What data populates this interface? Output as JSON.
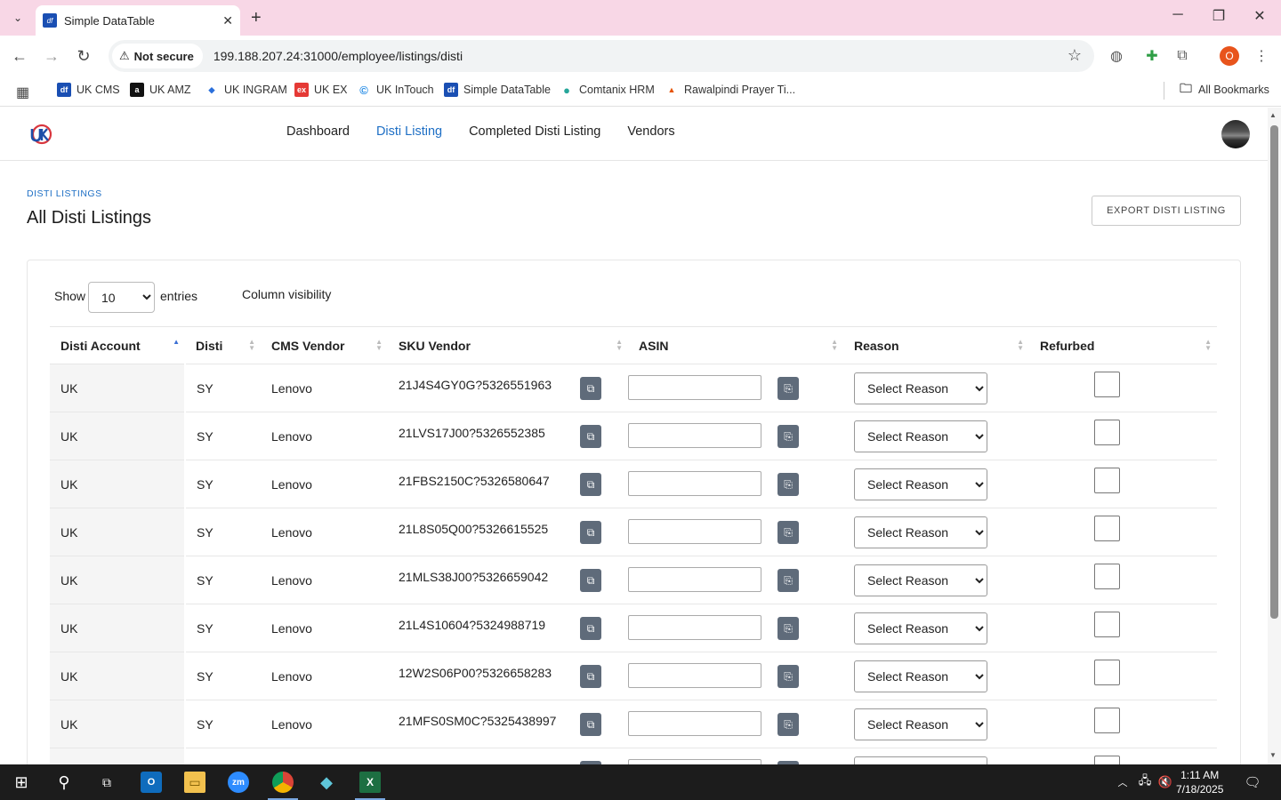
{
  "browser": {
    "tab_title": "Simple DataTable",
    "tab_favicon": "df",
    "security_label": "Not secure",
    "url": "199.188.207.24:31000/employee/listings/disti",
    "profile_initial": "O",
    "bookmarks": [
      {
        "label": "UK CMS",
        "color": "#1a4fb3",
        "glyph": "df"
      },
      {
        "label": "UK AMZ",
        "color": "#111111",
        "glyph": "a"
      },
      {
        "label": "UK INGRAM",
        "color": "#2a6fdb",
        "glyph": "◆"
      },
      {
        "label": "UK EX",
        "color": "#e53935",
        "glyph": "ex"
      },
      {
        "label": "UK InTouch",
        "color": "#1e88e5",
        "glyph": "©"
      },
      {
        "label": "Simple DataTable",
        "color": "#1a4fb3",
        "glyph": "df"
      },
      {
        "label": "Comtanix HRM",
        "color": "#26a69a",
        "glyph": "●"
      },
      {
        "label": "Rawalpindi Prayer Ti...",
        "color": "#e65100",
        "glyph": "▲"
      }
    ],
    "all_bookmarks_label": "All Bookmarks"
  },
  "app": {
    "nav": [
      "Dashboard",
      "Disti Listing",
      "Completed Disti Listing",
      "Vendors"
    ],
    "active_nav": "Disti Listing",
    "accent_color": "#1e6fc5"
  },
  "page": {
    "breadcrumb": "DISTI LISTINGS",
    "title": "All Disti Listings",
    "export_button": "EXPORT DISTI LISTING"
  },
  "table_controls": {
    "show_label": "Show",
    "entries_value": "10",
    "entries_label": "entries",
    "column_visibility": "Column visibility"
  },
  "table": {
    "headers": [
      "Disti Account",
      "Disti",
      "CMS Vendor",
      "SKU Vendor",
      "ASIN",
      "Reason",
      "Refurbed"
    ],
    "reason_placeholder": "Select Reason",
    "rows": [
      {
        "account": "UK",
        "disti": "SY",
        "vendor": "Lenovo",
        "sku": "21J4S4GY0G?5326551963"
      },
      {
        "account": "UK",
        "disti": "SY",
        "vendor": "Lenovo",
        "sku": "21LVS17J00?5326552385"
      },
      {
        "account": "UK",
        "disti": "SY",
        "vendor": "Lenovo",
        "sku": "21FBS2150C?5326580647"
      },
      {
        "account": "UK",
        "disti": "SY",
        "vendor": "Lenovo",
        "sku": "21L8S05Q00?5326615525"
      },
      {
        "account": "UK",
        "disti": "SY",
        "vendor": "Lenovo",
        "sku": "21MLS38J00?5326659042"
      },
      {
        "account": "UK",
        "disti": "SY",
        "vendor": "Lenovo",
        "sku": "21L4S10604?5324988719"
      },
      {
        "account": "UK",
        "disti": "SY",
        "vendor": "Lenovo",
        "sku": "12W2S06P00?5326658283"
      },
      {
        "account": "UK",
        "disti": "SY",
        "vendor": "Lenovo",
        "sku": "21MFS0SM0C?5325438997"
      },
      {
        "account": "",
        "disti": "",
        "vendor": "",
        "sku": ""
      }
    ]
  },
  "taskbar": {
    "time": "1:11 AM",
    "date": "7/18/2025"
  }
}
